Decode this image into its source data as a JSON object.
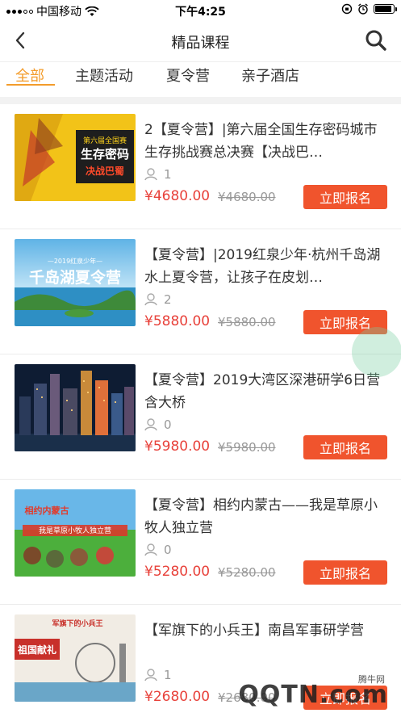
{
  "status_bar": {
    "carrier": "中国移动",
    "time": "下午4:25",
    "battery_level": 0.9
  },
  "header": {
    "title": "精品课程"
  },
  "tabs": [
    {
      "label": "全部",
      "active": true
    },
    {
      "label": "主题活动",
      "active": false
    },
    {
      "label": "夏令营",
      "active": false
    },
    {
      "label": "亲子酒店",
      "active": false
    }
  ],
  "courses": [
    {
      "title": "2【夏令营】|第六届全国生存密码城市生存挑战赛总决赛【决战巴…",
      "enrolled": "1",
      "price": "¥4680.00",
      "original_price": "¥4680.00",
      "button": "立即报名",
      "thumb_text": [
        "第六届全国赛",
        "生存密码",
        "决战巴蜀"
      ]
    },
    {
      "title": "【夏令营】|2019红泉少年·杭州千岛湖水上夏令营，让孩子在皮划…",
      "enrolled": "2",
      "price": "¥5880.00",
      "original_price": "¥5880.00",
      "button": "立即报名",
      "thumb_text": [
        "—2019红泉少年—",
        "千岛湖夏令营"
      ]
    },
    {
      "title": "【夏令营】2019大湾区深港研学6日营含大桥",
      "enrolled": "0",
      "price": "¥5980.00",
      "original_price": "¥5980.00",
      "button": "立即报名",
      "thumb_text": []
    },
    {
      "title": "【夏令营】相约内蒙古——我是草原小牧人独立营",
      "enrolled": "0",
      "price": "¥5280.00",
      "original_price": "¥5280.00",
      "button": "立即报名",
      "thumb_text": [
        "相约内蒙古",
        "我是草原小牧人独立营"
      ]
    },
    {
      "title": "【军旗下的小兵王】南昌军事研学营",
      "enrolled": "1",
      "price": "¥2680.00",
      "original_price": "¥2680.00",
      "button": "立即报名",
      "thumb_text": [
        "军旗下的小兵王",
        "祖国献礼"
      ]
    }
  ],
  "watermark": {
    "small": "腾牛网",
    "big": "QQTN.com"
  },
  "colors": {
    "accent_tab": "#f39c2b",
    "price": "#e8413a",
    "button": "#f0542d"
  }
}
